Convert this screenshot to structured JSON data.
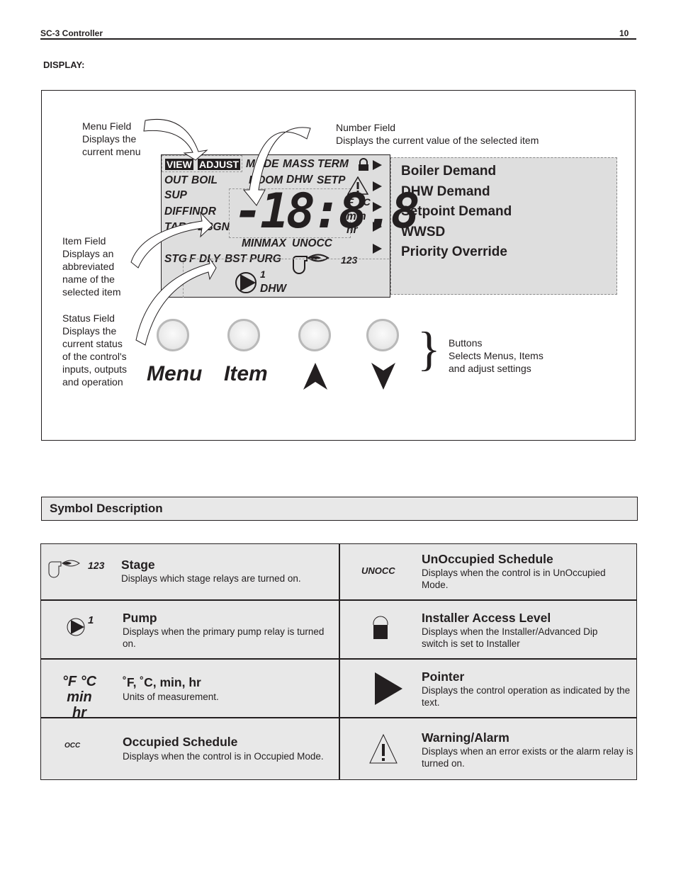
{
  "header": {
    "title": "SC-3 Controller",
    "page_number": "10"
  },
  "section_title": "DISPLAY:",
  "callouts": {
    "menu_field": [
      "Menu Field",
      "Displays the",
      "current menu"
    ],
    "number_field": [
      "Number Field",
      "Displays the current value of the selected item"
    ],
    "item_field": [
      "Item Field",
      "Displays an",
      "abbreviated",
      "name of the",
      "selected item"
    ],
    "status_field": [
      "Status Field",
      "Displays the",
      "current status",
      "of the control's",
      "inputs, outputs",
      "and operation"
    ],
    "buttons": [
      "Buttons",
      "Selects Menus, Items",
      "and adjust settings"
    ]
  },
  "lcd": {
    "menu": [
      "VIEW",
      "ADJUST"
    ],
    "top_row": [
      "MODE",
      "MASS",
      "TERM"
    ],
    "second_row": [
      "ROOM",
      "DHW",
      "SETP"
    ],
    "item_left": [
      "OUT",
      "BOIL",
      "SUP",
      "DIFF",
      "INDR",
      "TARG",
      "DSGN"
    ],
    "digits": "-18:8.8",
    "units": [
      "°F",
      "°C",
      "min",
      "hr"
    ],
    "minmax": "MINMAX",
    "unocc": "UNOCC",
    "status_row": [
      "STG",
      "F",
      "DLY",
      "BST",
      "PURG"
    ],
    "stage_numbers": "123",
    "pump_number": "1",
    "pump_label": "DHW"
  },
  "pointer_labels": [
    "Boiler Demand",
    "DHW Demand",
    "Setpoint Demand",
    "WWSD",
    "Priority Override"
  ],
  "buttons": [
    {
      "name": "menu",
      "label": "Menu"
    },
    {
      "name": "item",
      "label": "Item"
    },
    {
      "name": "up",
      "label": "▲"
    },
    {
      "name": "down",
      "label": "▼"
    }
  ],
  "symbol_description": {
    "title": "Symbol Description",
    "rows": [
      {
        "left": {
          "icon": "stage-icon",
          "icon_text": "123",
          "title": "Stage",
          "desc": "Displays which stage relays are turned on."
        },
        "right": {
          "icon": "unocc-icon",
          "icon_text": "UNOCC",
          "title": "UnOccupied Schedule",
          "desc": "Displays when the control is in UnOccupied Mode."
        }
      },
      {
        "left": {
          "icon": "pump-icon",
          "icon_text": "1",
          "title": "Pump",
          "desc": "Displays when the primary pump relay is turned on."
        },
        "right": {
          "icon": "lock-icon",
          "icon_text": "",
          "title": "Installer Access Level",
          "desc": "Displays when the Installer/Advanced Dip switch is set to Installer"
        }
      },
      {
        "left": {
          "icon": "units-icon",
          "icon_text": "°F °C",
          "icon_text2": "min hr",
          "title": "˚F, ˚C, min, hr",
          "desc": "Units of measurement."
        },
        "right": {
          "icon": "pointer-icon",
          "icon_text": "",
          "title": "Pointer",
          "desc": "Displays the control operation as indicated by the text."
        }
      },
      {
        "left": {
          "icon": "occ-icon",
          "icon_text": "OCC",
          "title": "Occupied Schedule",
          "desc": "Displays when the control is in Occupied Mode."
        },
        "right": {
          "icon": "warning-icon",
          "icon_text": "!",
          "title": "Warning/Alarm",
          "desc": "Displays when an error exists or the alarm relay is turned on."
        }
      }
    ]
  }
}
